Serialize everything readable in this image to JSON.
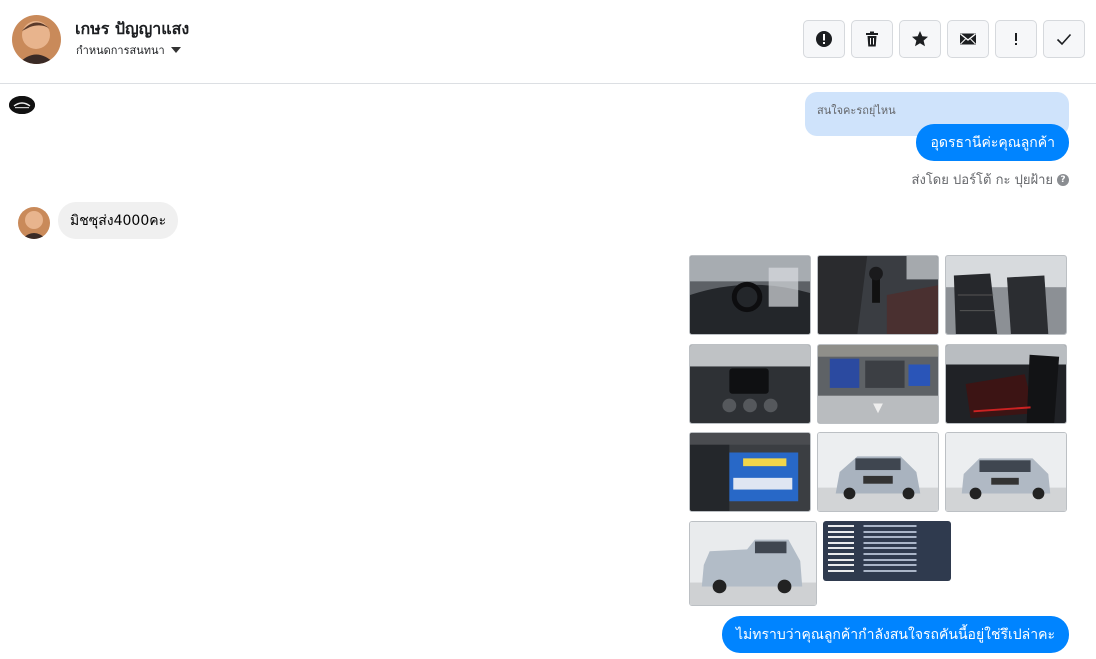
{
  "header": {
    "contact_name": "เกษร ปัญญาแสง",
    "assign_label": "กำหนดการสนทนา"
  },
  "toolbar": {
    "buttons": [
      {
        "name": "spam-button",
        "icon": "alert-circle-icon"
      },
      {
        "name": "delete-button",
        "icon": "trash-icon"
      },
      {
        "name": "star-button",
        "icon": "star-icon"
      },
      {
        "name": "mark-unread-button",
        "icon": "envelope-icon"
      },
      {
        "name": "follow-up-button",
        "icon": "exclamation-icon"
      },
      {
        "name": "done-button",
        "icon": "check-icon"
      }
    ]
  },
  "messages": {
    "reply_quote": "สนใจคะรถยุ่ไหน",
    "outgoing_1": "อุดรธานีค่ะคุณลูกค้า",
    "sent_by": "ส่งโดย ปอร์โต้ กะ ปุยฝ้าย",
    "incoming_1": "มิชซุส่ง4000คะ",
    "outgoing_2": "ไม่ทราบว่าคุณลูกค้ากำลังสนใจรถคันนี้อยู่ใช่รึเปล่าคะ"
  },
  "colors": {
    "outgoing_bubble": "#0084ff",
    "incoming_bubble": "#f0f0f0",
    "reply_quote": "#cfe3fb"
  }
}
